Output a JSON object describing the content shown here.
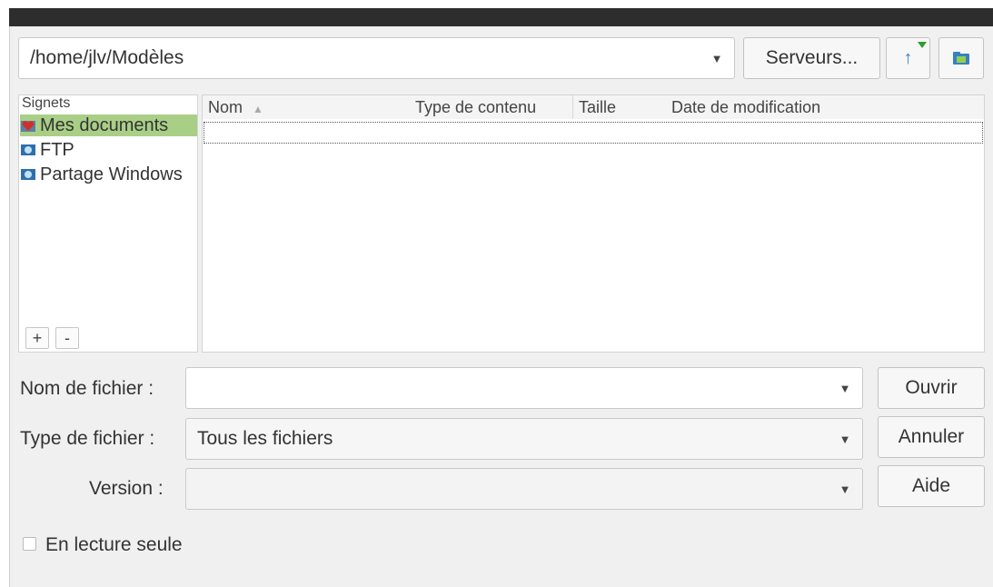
{
  "path_bar": {
    "value": "/home/jlv/Modèles"
  },
  "toolbar": {
    "servers_label": "Serveurs...",
    "up_icon": "arrow-up-icon",
    "newfolder_icon": "new-folder-icon"
  },
  "bookmarks": {
    "header": "Signets",
    "items": [
      {
        "label": "Mes documents",
        "icon": "heart-folder-icon"
      },
      {
        "label": "FTP",
        "icon": "network-folder-icon"
      },
      {
        "label": "Partage Windows",
        "icon": "network-folder-icon"
      }
    ],
    "add_label": "+",
    "remove_label": "-"
  },
  "file_list": {
    "columns": [
      "Nom",
      "Type de contenu",
      "Taille",
      "Date de modification"
    ]
  },
  "form": {
    "filename_label": "Nom de fichier :",
    "filename_value": "",
    "filetype_label": "Type de fichier :",
    "filetype_value": "Tous les fichiers",
    "version_label": "Version :",
    "version_value": ""
  },
  "buttons": {
    "open": "Ouvrir",
    "cancel": "Annuler",
    "help": "Aide"
  },
  "readonly": {
    "label": "En lecture seule",
    "checked": false
  },
  "colors": {
    "selection": "#a9cf87",
    "dark_bar": "#2d2d2d",
    "dialog_bg": "#f0f0f0"
  }
}
